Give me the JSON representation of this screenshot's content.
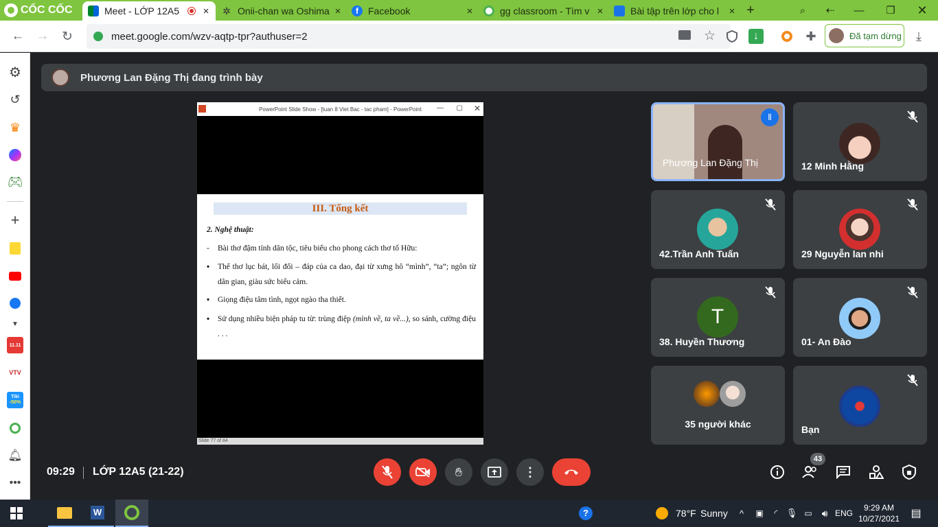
{
  "browser": {
    "logo": "CỐC CỐC",
    "tabs": [
      {
        "label": "Meet - LỚP 12A5",
        "active": true,
        "close": "×"
      },
      {
        "label": "Onii-chan wa Oshima",
        "active": false,
        "close": "×"
      },
      {
        "label": "Facebook",
        "active": false,
        "close": "×"
      },
      {
        "label": "gg classroom - Tìm v",
        "active": false,
        "close": "×"
      },
      {
        "label": "Bài tập trên lớp cho l",
        "active": false,
        "close": "×"
      }
    ],
    "new_tab": "+",
    "url": "meet.google.com/wzv-aqtp-tpr?authuser=2",
    "paused_label": "Đã tạm dừng"
  },
  "meet": {
    "presenting_banner": "Phương Lan Đặng Thị đang trình bày",
    "time": "09:29",
    "meeting_name": "LỚP 12A5 (21-22)",
    "people_count": "43"
  },
  "presentation": {
    "window_title": "PowerPoint Slide Show - [tuan 8 Viet Bac - tac pham] - PowerPoint",
    "slide_title": "III. Tổng kết",
    "subheading": "2. Nghệ thuật:",
    "bullets": [
      {
        "marker": "-",
        "text": "Bài thơ đậm tính dân tộc, tiêu biểu cho phong cách thơ tố Hữu:"
      },
      {
        "marker": "▪",
        "text": "Thể thơ lục bát, lối đối – đáp của ca dao, đại từ xưng hô “mình”, “ta”; ngôn từ dân gian, giàu sức biểu cảm."
      },
      {
        "marker": "▪",
        "text": "Giọng điệu tâm tình, ngọt ngào tha thiết."
      },
      {
        "marker": "▪",
        "text": "Sử dụng nhiều biện pháp tu từ: trùng điệp",
        "italic": "(mình về, ta về...)",
        "after": ", so sánh, cường điệu . . ."
      }
    ],
    "status": "Slide 77 of 84"
  },
  "participants": [
    {
      "name": "Phương Lan Đặng Thị",
      "muted": false,
      "speaking": true
    },
    {
      "name": "12 Minh Hằng",
      "muted": true
    },
    {
      "name": "42.Trần Anh Tuấn",
      "muted": true
    },
    {
      "name": "29 Nguyễn lan nhi",
      "muted": true
    },
    {
      "name": "38. Huyền Thương",
      "muted": true,
      "initial": "T"
    },
    {
      "name": "01- An Đào",
      "muted": true
    },
    {
      "name": "35 người khác",
      "muted": false
    },
    {
      "name": "Bạn",
      "muted": true
    }
  ],
  "taskbar": {
    "temperature": "78°F",
    "weather": "Sunny",
    "language": "ENG",
    "time": "9:29 AM",
    "date": "10/27/2021"
  },
  "sidebar": {
    "tiki_label": "Tiki",
    "tiki_discount": "-50%",
    "vtv_label": "VTV",
    "shopping_label": "11.11"
  }
}
